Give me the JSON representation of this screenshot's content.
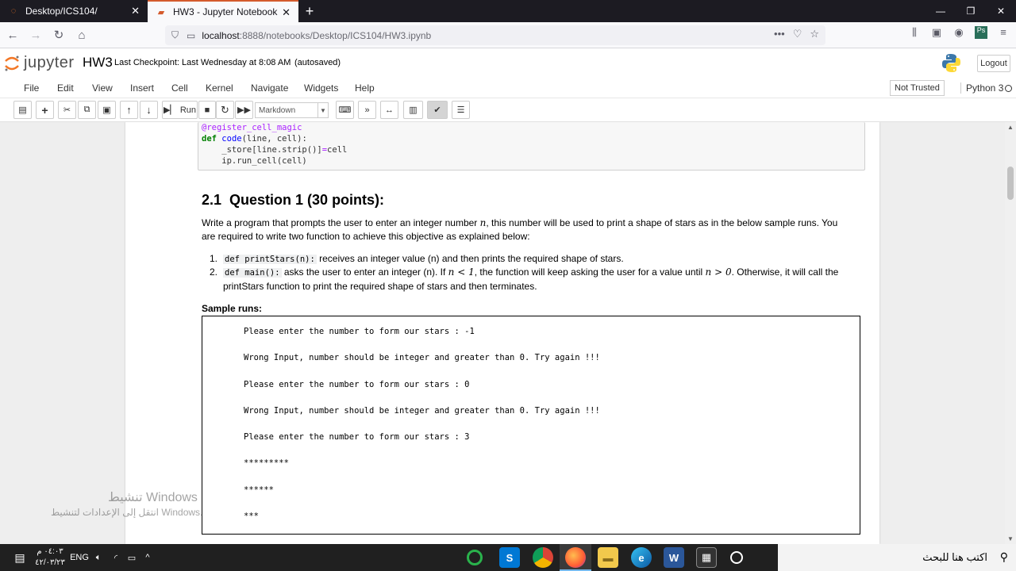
{
  "browser": {
    "tabs": [
      {
        "title": "Desktop/ICS104/",
        "active": false
      },
      {
        "title": "HW3 - Jupyter Notebook",
        "active": true
      }
    ],
    "url_host": "localhost",
    "url_path": ":8888/notebooks/Desktop/ICS104/HW3.ipynb"
  },
  "jupyter": {
    "logo_word": "jupyter",
    "notebook_name": "HW3",
    "checkpoint": "Last Checkpoint: Last Wednesday at 8:08 AM",
    "autosaved": "(autosaved)",
    "logout": "Logout",
    "menu": [
      "File",
      "Edit",
      "View",
      "Insert",
      "Cell",
      "Kernel",
      "Navigate",
      "Widgets",
      "Help"
    ],
    "trust": "Not Trusted",
    "kernel": "Python 3",
    "toolbar": {
      "run_label": "Run",
      "cell_type": "Markdown"
    }
  },
  "code_cell": {
    "lines": [
      "@register_cell_magic",
      "def code(line, cell):",
      "    _store[line.strip()]=cell",
      "    ip.run_cell(cell)"
    ]
  },
  "content": {
    "heading_num": "2.1",
    "heading_text": "Question 1 (30 points):",
    "intro_a": "Write a program that prompts the user to enter an integer number ",
    "intro_var": "n",
    "intro_b": ", this number will be used to print a shape of stars as in the below sample runs. You are required to write two function to achieve this objective as explained below:",
    "items": [
      {
        "num": "1.",
        "code": "def printStars(n):",
        "text": " receives an integer value (n) and then prints the required shape of stars."
      },
      {
        "num": "2.",
        "code": "def main():",
        "text_a": " asks the user to enter an integer (n). If ",
        "math_a": "n < 1",
        "text_b": ", the function will keep asking the user for a value until ",
        "math_b": "n > 0",
        "text_c": ". Otherwise, it will call the printStars function to print the required shape of stars and then terminates."
      }
    ],
    "sample_title": "Sample runs:",
    "sample_lines": [
      "Please enter the number to form our stars : -1",
      "Wrong Input, number should be integer and greater than 0. Try again !!!",
      "Please enter the number to form our stars : 0",
      "Wrong Input, number should be integer and greater than 0. Try again !!!",
      "Please enter the number to form our stars : 3",
      "*********",
      "******",
      "***"
    ]
  },
  "watermark": {
    "line1": "تنشيط Windows",
    "line2": "انتقل إلى الإعدادات لتنشيط Windows."
  },
  "taskbar": {
    "search_placeholder": "اكتب هنا للبحث",
    "lang": "ENG",
    "time": "٠٤:٠٣ م",
    "date": "٤٢/٠٣/٢٣"
  },
  "colors": {
    "firefox_dark": "#1c1b22",
    "accent_tab": "#d45a2c",
    "jupyter_orange": "#f37726",
    "taskbar": "#202020"
  }
}
